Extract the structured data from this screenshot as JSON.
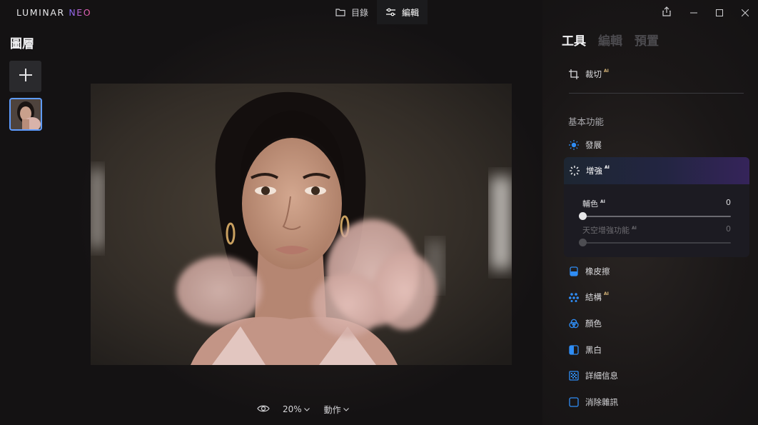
{
  "app": {
    "logo_main": "LUMINAR ",
    "logo_accent": "NEO"
  },
  "topnav": {
    "catalog_label": "目錄",
    "edit_label": "編輯"
  },
  "layers": {
    "title": "圖層"
  },
  "right_panel": {
    "tabs": [
      "工具",
      "編輯",
      "預置"
    ],
    "crop": {
      "label": "裁切",
      "ai": "AI"
    },
    "section_title": "基本功能",
    "develop_label": "發展",
    "enhance": {
      "label": "增強",
      "ai": "AI",
      "sliders": [
        {
          "label": "輔色",
          "ai": "AI",
          "value": "0",
          "level": 0
        },
        {
          "label": "天空增強功能",
          "ai": "AI",
          "value": "0",
          "level": 0
        }
      ]
    },
    "tools": [
      {
        "label": "橡皮擦",
        "ai": "",
        "icon": "eraser-icon"
      },
      {
        "label": "結構",
        "ai": "AI",
        "icon": "structure-icon"
      },
      {
        "label": "顏色",
        "ai": "",
        "icon": "color-icon"
      },
      {
        "label": "黑白",
        "ai": "",
        "icon": "bw-icon"
      },
      {
        "label": "詳細信息",
        "ai": "",
        "icon": "details-icon"
      },
      {
        "label": "消除雜訊",
        "ai": "",
        "icon": "denoise-icon"
      }
    ]
  },
  "bottombar": {
    "zoom": "20%",
    "actions": "動作"
  },
  "colors": {
    "accent_blue": "#5f9cff",
    "ai_gold": "#d8b77a",
    "enhance_gradient_end": "#35245a"
  }
}
